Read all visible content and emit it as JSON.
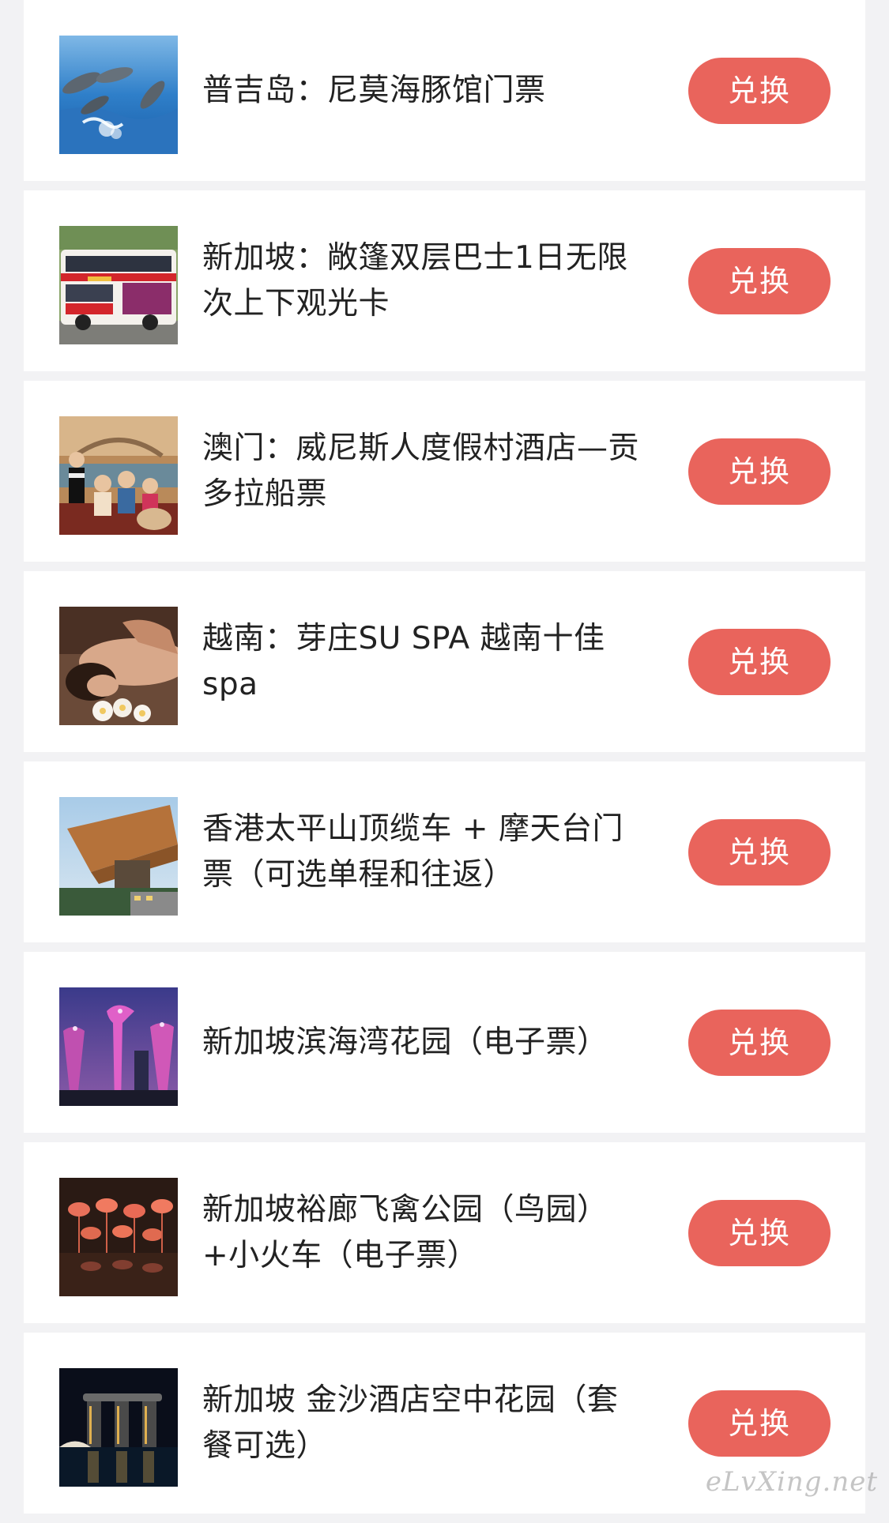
{
  "items": [
    {
      "title": "普吉岛：尼莫海豚馆门票",
      "button": "兑换",
      "thumb": "dolphins"
    },
    {
      "title": "新加坡：敞篷双层巴士1日无限次上下观光卡",
      "button": "兑换",
      "thumb": "double-decker-bus"
    },
    {
      "title": "澳门：威尼斯人度假村酒店—贡多拉船票",
      "button": "兑换",
      "thumb": "gondola-family"
    },
    {
      "title": "越南：芽庄SU SPA 越南十佳spa",
      "button": "兑换",
      "thumb": "spa-massage"
    },
    {
      "title": "香港太平山顶缆车 + 摩天台门票（可选单程和往返）",
      "button": "兑换",
      "thumb": "peak-tower"
    },
    {
      "title": "新加坡滨海湾花园（电子票）",
      "button": "兑换",
      "thumb": "supertrees"
    },
    {
      "title": "新加坡裕廊飞禽公园（鸟园）+小火车（电子票）",
      "button": "兑换",
      "thumb": "flamingos"
    },
    {
      "title": "新加坡 金沙酒店空中花园（套餐可选）",
      "button": "兑换",
      "thumb": "marina-bay-sands"
    }
  ],
  "watermark": "eLvXing.net",
  "colors": {
    "accent": "#e9645c",
    "background": "#f2f2f4",
    "card": "#ffffff",
    "text": "#222222"
  }
}
